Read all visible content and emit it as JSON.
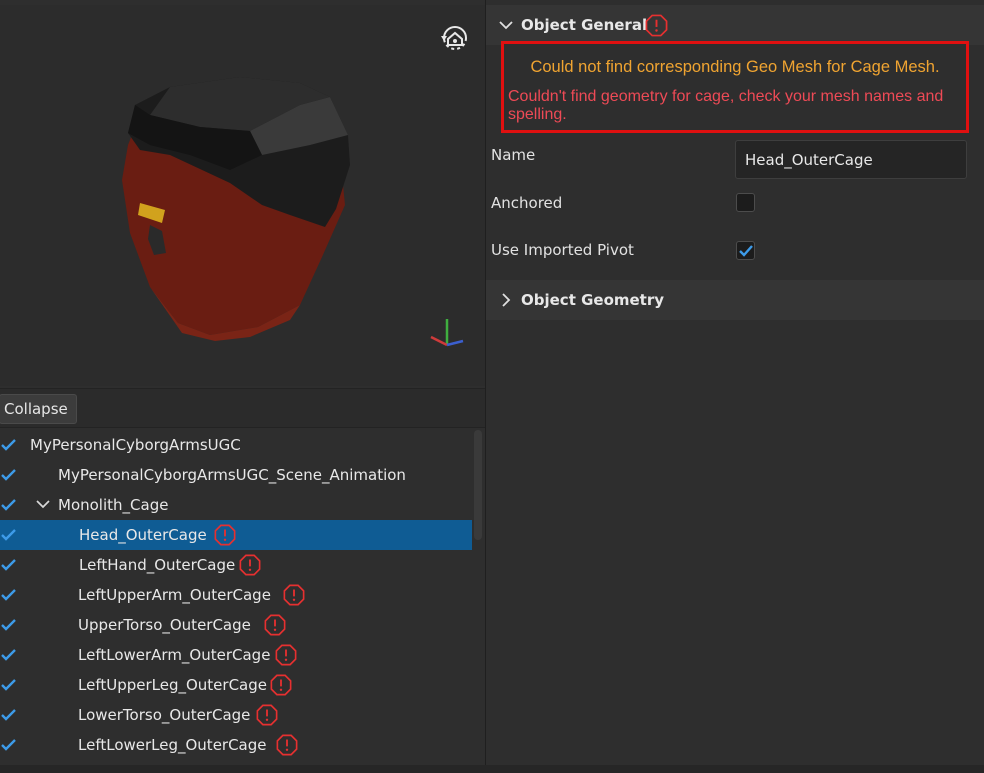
{
  "viewport": {
    "rotate_icon": "rotate-view-icon",
    "axis_gizmo": "axis-gizmo-icon",
    "colors": {
      "hair": "#1a1a1a",
      "skin": "#6a1d12",
      "accent": "#d1a21d"
    }
  },
  "collapse_button": "Collapse",
  "tree": {
    "rows": [
      {
        "label": "MyPersonalCyborgArmsUGC",
        "checked": true,
        "warning": false,
        "selected": false,
        "expandable": false
      },
      {
        "label": "MyPersonalCyborgArmsUGC_Scene_Animation",
        "checked": true,
        "warning": false,
        "selected": false,
        "expandable": false
      },
      {
        "label": "Monolith_Cage",
        "checked": true,
        "warning": false,
        "selected": false,
        "expandable": true
      },
      {
        "label": "Head_OuterCage",
        "checked": true,
        "warning": true,
        "selected": true,
        "expandable": false
      },
      {
        "label": "LeftHand_OuterCage",
        "checked": true,
        "warning": true,
        "selected": false,
        "expandable": false
      },
      {
        "label": "LeftUpperArm_OuterCage",
        "checked": true,
        "warning": true,
        "selected": false,
        "expandable": false
      },
      {
        "label": "UpperTorso_OuterCage",
        "checked": true,
        "warning": true,
        "selected": false,
        "expandable": false
      },
      {
        "label": "LeftLowerArm_OuterCage",
        "checked": true,
        "warning": true,
        "selected": false,
        "expandable": false
      },
      {
        "label": "LeftUpperLeg_OuterCage",
        "checked": true,
        "warning": true,
        "selected": false,
        "expandable": false
      },
      {
        "label": "LowerTorso_OuterCage",
        "checked": true,
        "warning": true,
        "selected": false,
        "expandable": false
      },
      {
        "label": "LeftLowerLeg_OuterCage",
        "checked": true,
        "warning": true,
        "selected": false,
        "expandable": false
      }
    ]
  },
  "properties": {
    "object_general": {
      "title": "Object General",
      "has_warning": true,
      "error_primary": "Could not find corresponding Geo Mesh for Cage Mesh.",
      "error_secondary": "Couldn't find geometry for cage, check your mesh names and spelling.",
      "name_label": "Name",
      "name_value": "Head_OuterCage",
      "anchored_label": "Anchored",
      "anchored_checked": false,
      "pivot_label": "Use Imported Pivot",
      "pivot_checked": true
    },
    "object_geometry": {
      "title": "Object Geometry",
      "expanded": false
    }
  },
  "colors": {
    "accent_blue": "#3d9be9",
    "selected_row": "#0f5c94",
    "warning_red": "#e63030",
    "error_border": "#e01010",
    "error_orange": "#f0a431",
    "error_red": "#ee4a56"
  }
}
